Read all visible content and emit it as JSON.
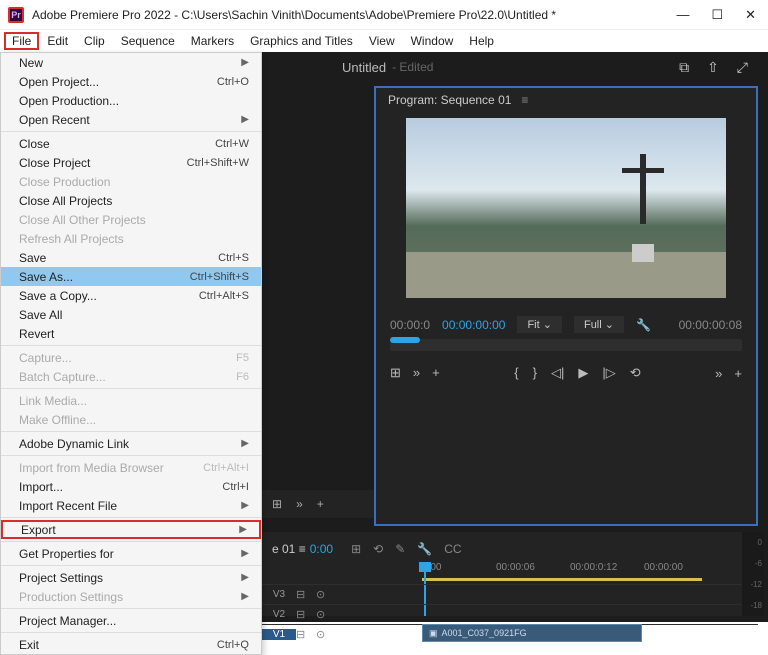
{
  "titlebar": {
    "title": "Adobe Premiere Pro 2022 - C:\\Users\\Sachin Vinith\\Documents\\Adobe\\Premiere Pro\\22.0\\Untitled *",
    "app_glyph": "Pr"
  },
  "winctrl": {
    "min": "—",
    "max": "☐",
    "close": "✕"
  },
  "menubar": [
    "File",
    "Edit",
    "Clip",
    "Sequence",
    "Markers",
    "Graphics and Titles",
    "View",
    "Window",
    "Help"
  ],
  "dropdown": [
    {
      "label": "New",
      "arrow": true
    },
    {
      "label": "Open Project...",
      "shortcut": "Ctrl+O"
    },
    {
      "label": "Open Production..."
    },
    {
      "label": "Open Recent",
      "arrow": true
    },
    {
      "sep": true
    },
    {
      "label": "Close",
      "shortcut": "Ctrl+W"
    },
    {
      "label": "Close Project",
      "shortcut": "Ctrl+Shift+W"
    },
    {
      "label": "Close Production",
      "dim": true
    },
    {
      "label": "Close All Projects"
    },
    {
      "label": "Close All Other Projects",
      "dim": true
    },
    {
      "label": "Refresh All Projects",
      "dim": true
    },
    {
      "label": "Save",
      "shortcut": "Ctrl+S"
    },
    {
      "label": "Save As...",
      "shortcut": "Ctrl+Shift+S",
      "hov": true
    },
    {
      "label": "Save a Copy...",
      "shortcut": "Ctrl+Alt+S"
    },
    {
      "label": "Save All"
    },
    {
      "label": "Revert"
    },
    {
      "sep": true
    },
    {
      "label": "Capture...",
      "shortcut": "F5",
      "dim": true
    },
    {
      "label": "Batch Capture...",
      "shortcut": "F6",
      "dim": true
    },
    {
      "sep": true
    },
    {
      "label": "Link Media...",
      "dim": true
    },
    {
      "label": "Make Offline...",
      "dim": true
    },
    {
      "sep": true
    },
    {
      "label": "Adobe Dynamic Link",
      "arrow": true
    },
    {
      "sep": true
    },
    {
      "label": "Import from Media Browser",
      "shortcut": "Ctrl+Alt+I",
      "dim": true
    },
    {
      "label": "Import...",
      "shortcut": "Ctrl+I"
    },
    {
      "label": "Import Recent File",
      "arrow": true
    },
    {
      "sep": true
    },
    {
      "label": "Export",
      "arrow": true,
      "export": true
    },
    {
      "sep": true
    },
    {
      "label": "Get Properties for",
      "arrow": true
    },
    {
      "sep": true
    },
    {
      "label": "Project Settings",
      "arrow": true
    },
    {
      "label": "Production Settings",
      "arrow": true,
      "dim": true
    },
    {
      "sep": true
    },
    {
      "label": "Project Manager..."
    },
    {
      "sep": true
    },
    {
      "label": "Exit",
      "shortcut": "Ctrl+Q"
    }
  ],
  "ws": {
    "tab": "Untitled",
    "edited": "- Edited"
  },
  "program": {
    "tab": "Program: Sequence 01",
    "t_left": "00:00:0",
    "t_main": "00:00:00:00",
    "fit": "Fit",
    "full": "Full",
    "t_right": "00:00:00:08"
  },
  "seq": {
    "tab": "e 01 ≡",
    "playhead": "0:00",
    "ruler": [
      "3:00",
      "00:00:06",
      "00:00:0:12",
      "00:00:00"
    ],
    "tracks": [
      "V3",
      "V2",
      "V1"
    ],
    "clip": "A001_C037_0921FG"
  },
  "meter": [
    "0",
    "-6",
    "-12",
    "-18"
  ],
  "glyph": {
    "newwin": "⧉",
    "share": "⇧",
    "expand": "⤢",
    "more": "≡",
    "chev": "⌄",
    "wrench": "🔧",
    "mark_in": "{",
    "mark_out": "}",
    "step_b": "◁|",
    "play": "▶",
    "step_f": "|▷",
    "plus": "+",
    "raquo": "»",
    "snap": "⊞",
    "link": "⟲",
    "tool": "✎",
    "cc": "CC",
    "film": "▣",
    "eye": "⊙",
    "target": "⊟"
  }
}
